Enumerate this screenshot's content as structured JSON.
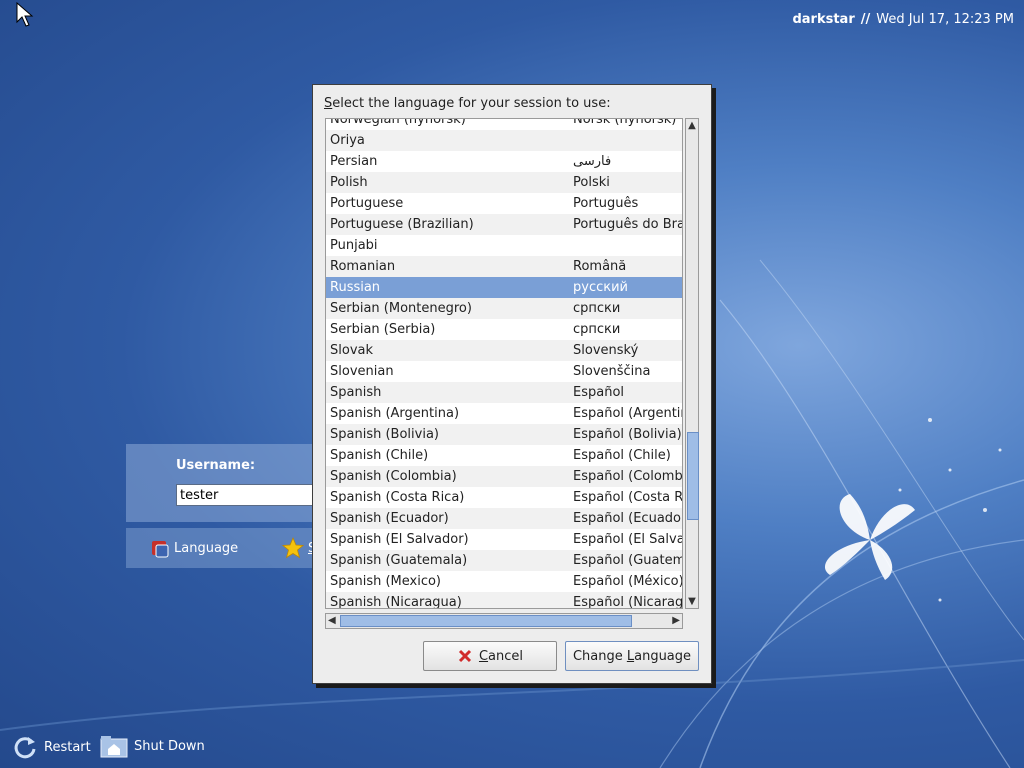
{
  "topbar": {
    "hostname": "darkstar",
    "separator": "//",
    "datetime": "Wed Jul 17, 12:23 PM"
  },
  "login": {
    "username_label": "Username:",
    "username_value": "tester"
  },
  "options": {
    "language_label": "Language",
    "session_label_fragment": "S"
  },
  "bottom": {
    "restart_label": "Restart",
    "shutdown_label": "Shut Down"
  },
  "dialog": {
    "title_first": "S",
    "title_rest": "elect the language for your session to use:",
    "selected_language": "Russian",
    "rows": [
      {
        "en": "Norwegian (nynorsk)",
        "native": "Norsk (nynorsk)"
      },
      {
        "en": "Oriya",
        "native": ""
      },
      {
        "en": "Persian",
        "native": "فارسی"
      },
      {
        "en": "Polish",
        "native": "Polski"
      },
      {
        "en": "Portuguese",
        "native": "Português"
      },
      {
        "en": "Portuguese (Brazilian)",
        "native": "Português do Brasil"
      },
      {
        "en": "Punjabi",
        "native": ""
      },
      {
        "en": "Romanian",
        "native": "Română"
      },
      {
        "en": "Russian",
        "native": "русский"
      },
      {
        "en": "Serbian (Montenegro)",
        "native": "српски"
      },
      {
        "en": "Serbian (Serbia)",
        "native": "српски"
      },
      {
        "en": "Slovak",
        "native": "Slovenský"
      },
      {
        "en": "Slovenian",
        "native": "Slovenščina"
      },
      {
        "en": "Spanish",
        "native": "Español"
      },
      {
        "en": "Spanish (Argentina)",
        "native": "Español (Argentina)"
      },
      {
        "en": "Spanish (Bolivia)",
        "native": "Español (Bolivia)"
      },
      {
        "en": "Spanish (Chile)",
        "native": "Español (Chile)"
      },
      {
        "en": "Spanish (Colombia)",
        "native": "Español (Colombia)"
      },
      {
        "en": "Spanish (Costa Rica)",
        "native": "Español (Costa Rica)"
      },
      {
        "en": "Spanish (Ecuador)",
        "native": "Español (Ecuador)"
      },
      {
        "en": "Spanish (El Salvador)",
        "native": "Español (El Salvador)"
      },
      {
        "en": "Spanish (Guatemala)",
        "native": "Español (Guatemala)"
      },
      {
        "en": "Spanish (Mexico)",
        "native": "Español (México)"
      },
      {
        "en": "Spanish (Nicaragua)",
        "native": "Español (Nicaragua)"
      }
    ],
    "cancel_label_first": "C",
    "cancel_label_rest": "ancel",
    "change_label_pre": "Change ",
    "change_label_u": "L",
    "change_label_post": "anguage"
  }
}
